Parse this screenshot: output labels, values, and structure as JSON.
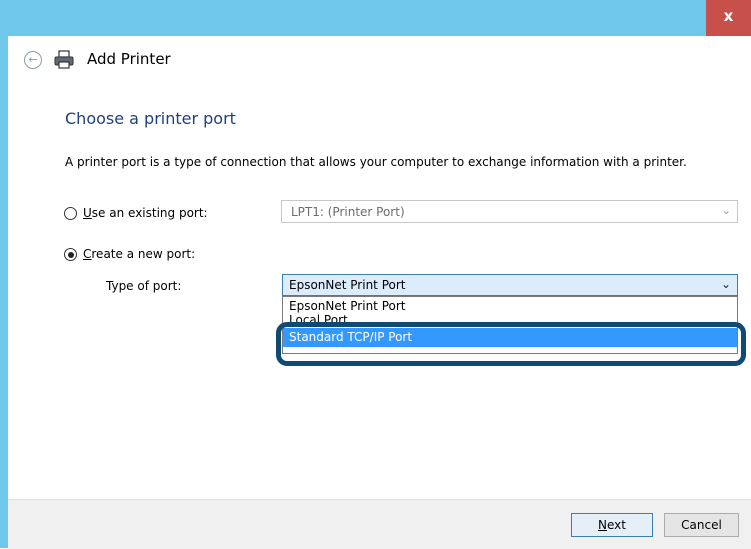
{
  "window": {
    "close_glyph": "x",
    "title": "Add Printer"
  },
  "page": {
    "heading": "Choose a printer port",
    "description": "A printer port is a type of connection that allows your computer to exchange information with a printer."
  },
  "options": {
    "existing": {
      "label_mnemonic": "U",
      "label_rest": "se an existing port:",
      "selected": false,
      "value": "LPT1: (Printer Port)"
    },
    "create": {
      "label_mnemonic": "C",
      "label_rest": "reate a new port:",
      "selected": true
    },
    "type_of_port_label": "Type of port:",
    "type_of_port_value": "EpsonNet Print Port",
    "dropdown_items": [
      "EpsonNet Print Port",
      "Local Port",
      "Standard TCP/IP Port"
    ],
    "highlighted_item_index": 2
  },
  "footer": {
    "next_mnemonic": "N",
    "next_rest": "ext",
    "cancel_label": "Cancel"
  },
  "colors": {
    "title_bar": "#6ec8ea",
    "close_button": "#c7504a",
    "heading": "#1f3f7f",
    "selection": "#3399ff",
    "callout_ring": "#0e4a73"
  },
  "icons": {
    "back": "back-arrow-icon",
    "printer": "printer-icon",
    "dropdown": "chevron-down-icon"
  }
}
